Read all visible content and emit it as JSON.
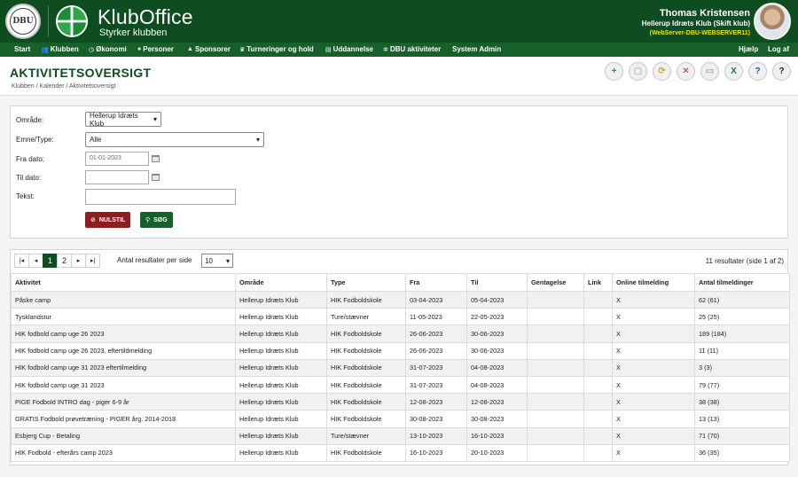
{
  "header": {
    "dbu_logo_text": "DBU",
    "brand_title": "KlubOffice",
    "brand_subtitle": "Styrker klubben",
    "user_name": "Thomas Kristensen",
    "user_club": "Hellerup Idræts Klub (Skift klub)",
    "user_server": "(WebServer-DBU-WEBSERVER11)",
    "brand_color": "#0d4d1f"
  },
  "nav": {
    "items": [
      {
        "label": "Start",
        "icon": ""
      },
      {
        "label": "Klubben",
        "icon": "people-icon"
      },
      {
        "label": "Økonomi",
        "icon": "coin-icon"
      },
      {
        "label": "Personer",
        "icon": "person-icon"
      },
      {
        "label": "Sponsorer",
        "icon": "sponsor-icon"
      },
      {
        "label": "Turneringer og hold",
        "icon": "trophy-icon"
      },
      {
        "label": "Uddannelse",
        "icon": "book-icon"
      },
      {
        "label": "DBU aktiviteter",
        "icon": "ball-icon"
      },
      {
        "label": "System Admin",
        "icon": ""
      }
    ],
    "right": [
      {
        "label": "Hjælp"
      },
      {
        "label": "Log af"
      }
    ]
  },
  "page": {
    "title": "AKTIVITETSOVERSIGT",
    "breadcrumb": "Klubben / Kalender / Aktivitetsoversigt"
  },
  "toolbar": [
    {
      "name": "add-icon",
      "glyph": "+",
      "color": "#2e9a2e"
    },
    {
      "name": "document-icon",
      "glyph": "▢",
      "color": "#7a9cc4"
    },
    {
      "name": "copy-icon",
      "glyph": "⟳",
      "color": "#d4a500"
    },
    {
      "name": "delete-icon",
      "glyph": "✕",
      "color": "#cc2222"
    },
    {
      "name": "print-icon",
      "glyph": "▭",
      "color": "#777777"
    },
    {
      "name": "excel-icon",
      "glyph": "X",
      "color": "#1d7a34"
    },
    {
      "name": "help-circle-icon",
      "glyph": "?",
      "color": "#2a4fa8"
    },
    {
      "name": "question-icon",
      "glyph": "?",
      "color": "#222222"
    }
  ],
  "filter": {
    "omraade_label": "Område:",
    "omraade_value": "Hellerup Idræts Klub",
    "emne_label": "Emne/Type:",
    "emne_value": "Alle",
    "fra_label": "Fra dato:",
    "fra_value": "01-01-2023",
    "til_label": "Til dato:",
    "til_value": "",
    "tekst_label": "Tekst:",
    "tekst_value": "",
    "reset_label": "NULSTIL",
    "search_label": "SØG"
  },
  "results": {
    "pages": [
      "1",
      "2"
    ],
    "current_page": "1",
    "per_page_label": "Antal resultater per side",
    "per_page_value": "10",
    "count_text": "11 resultater (side 1 af 2)",
    "columns": [
      "Aktivitet",
      "Område",
      "Type",
      "Fra",
      "Til",
      "Gentagelse",
      "Link",
      "Online tilmelding",
      "Antal tilmeldinger"
    ],
    "rows": [
      [
        "Påske camp",
        "Hellerup Idræts Klub",
        "HIK Fodboldskole",
        "03-04-2023",
        "05-04-2023",
        "",
        "",
        "X",
        "62 (61)"
      ],
      [
        "Tysklandstur",
        "Hellerup Idræts Klub",
        "Ture/stævner",
        "11-05-2023",
        "22-05-2023",
        "",
        "",
        "X",
        "25 (25)"
      ],
      [
        "HIK fodbold camp uge 26 2023",
        "Hellerup Idræts Klub",
        "HIK Fodboldskole",
        "26-06-2023",
        "30-06-2023",
        "",
        "",
        "X",
        "189 (184)"
      ],
      [
        "HIK fodbold camp uge 26 2023, eftertildmelding",
        "Hellerup Idræts Klub",
        "HIK Fodboldskole",
        "26-06-2023",
        "30-06-2023",
        "",
        "",
        "X",
        "11 (11)"
      ],
      [
        "HIK fodbold camp uge 31 2023 eftertilmelding",
        "Hellerup Idræts Klub",
        "HIK Fodboldskole",
        "31-07-2023",
        "04-08-2023",
        "",
        "",
        "X",
        "3 (3)"
      ],
      [
        "HIK fodbold camp uge 31 2023",
        "Hellerup Idræts Klub",
        "HIK Fodboldskole",
        "31-07-2023",
        "04-08-2023",
        "",
        "",
        "X",
        "79 (77)"
      ],
      [
        "PIGE Fodbold INTRO dag - piger 6-9 år",
        "Hellerup Idræts Klub",
        "HIK Fodboldskole",
        "12-08-2023",
        "12-08-2023",
        "",
        "",
        "X",
        "38 (38)"
      ],
      [
        "GRATIS Fodbold prøvetræning - PIGER årg. 2014-2018",
        "Hellerup Idræts Klub",
        "HIK Fodboldskole",
        "30-08-2023",
        "30-08-2023",
        "",
        "",
        "X",
        "13 (13)"
      ],
      [
        "Esbjerg Cup - Betaling",
        "Hellerup Idræts Klub",
        "Ture/stævner",
        "13-10-2023",
        "16-10-2023",
        "",
        "",
        "X",
        "71 (70)"
      ],
      [
        "HIK Fodbold - efterårs camp 2023",
        "Hellerup Idræts Klub",
        "HIK Fodboldskole",
        "16-10-2023",
        "20-10-2023",
        "",
        "",
        "X",
        "36 (35)"
      ]
    ]
  }
}
